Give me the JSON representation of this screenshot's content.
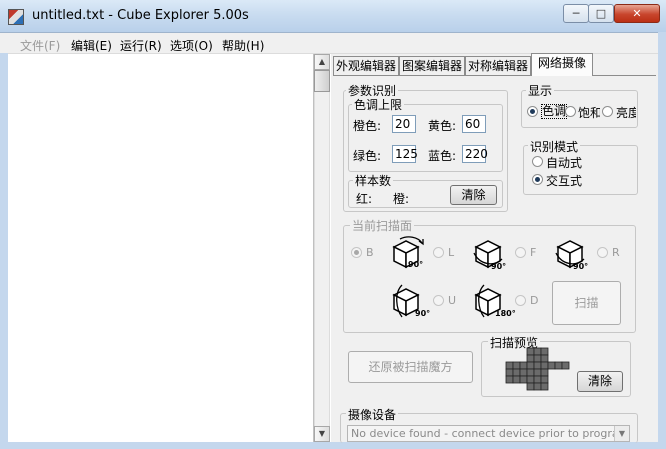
{
  "window": {
    "title": "untitled.txt - Cube Explorer 5.00s",
    "min_glyph": "─",
    "max_glyph": "□",
    "close_glyph": "✕"
  },
  "menu": [
    "文件(F)",
    "编辑(E)",
    "运行(R)",
    "选项(O)",
    "帮助(H)"
  ],
  "tabs": [
    "外观编辑器",
    "图案编辑器",
    "对称编辑器",
    "网络摄像"
  ],
  "active_tab": "网络摄像",
  "param": {
    "legend": "参数识别",
    "hue_limit": {
      "legend": "色调上限",
      "fields": [
        {
          "label": "橙色:",
          "value": "20"
        },
        {
          "label": "黄色:",
          "value": "60"
        },
        {
          "label": "绿色:",
          "value": "125"
        },
        {
          "label": "蓝色:",
          "value": "220"
        }
      ]
    },
    "samples": {
      "legend": "样本数",
      "red_label": "红:",
      "orange_label": "橙:",
      "clear_label": "清除"
    }
  },
  "display": {
    "legend": "显示",
    "options": [
      "色调",
      "饱和",
      "亮度"
    ],
    "selected": "色调"
  },
  "recog_mode": {
    "legend": "识别模式",
    "options": [
      "自动式",
      "交互式"
    ],
    "selected": "交互式"
  },
  "scan_face": {
    "legend": "当前扫描面",
    "faces": [
      {
        "letter": "B",
        "angle": "90°",
        "selected": true
      },
      {
        "letter": "L",
        "angle": "90°",
        "selected": false
      },
      {
        "letter": "F",
        "angle": "90°",
        "selected": false
      },
      {
        "letter": "R",
        "angle": "90°",
        "selected": false
      },
      {
        "letter": "U",
        "angle": "90°",
        "selected": false
      },
      {
        "letter": "D",
        "angle": "180°",
        "selected": false
      }
    ],
    "scan_label": "扫描"
  },
  "restore_label": "还原被扫描魔方",
  "preview": {
    "legend": "扫描预览",
    "clear_label": "清除"
  },
  "device": {
    "legend": "摄像设备",
    "dropdown_text": "No device found - connect device prior to program start!"
  }
}
